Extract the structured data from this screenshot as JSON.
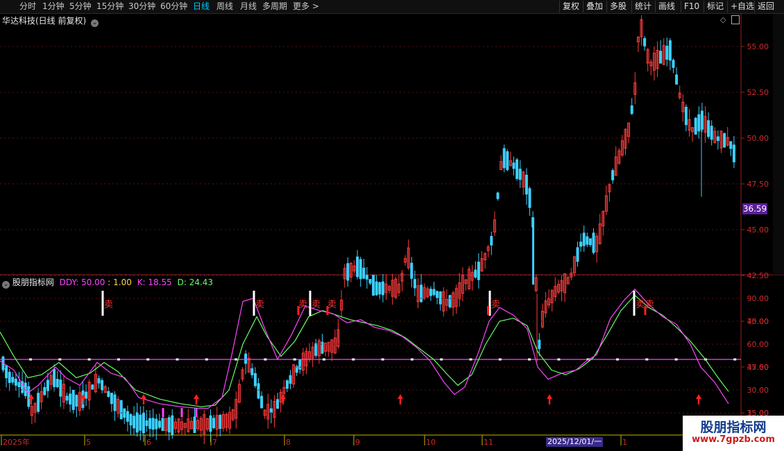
{
  "toolbar": {
    "periods": [
      "分时",
      "1分钟",
      "5分钟",
      "15分钟",
      "30分钟",
      "60分钟",
      "日线",
      "周线",
      "月线",
      "多周期",
      "更多 >"
    ],
    "active_period": "日线",
    "buttons": [
      "复权",
      "叠加",
      "多股",
      "统计",
      "画线",
      "F10",
      "标记",
      "+自选",
      "返回"
    ]
  },
  "stock": {
    "title": "华达科技(日线 前复权)",
    "current_price_tag": "36.59"
  },
  "price_axis": {
    "ticks": [
      "55.00",
      "52.50",
      "50.00",
      "47.50",
      "45.00",
      "42.50",
      "40.00",
      "37.50",
      "35.00"
    ]
  },
  "indicator": {
    "name": "股朋指标网",
    "ddy_label": "DDY: 50.00",
    "one_label": ": 1.00",
    "k_label": "K: 18.55",
    "d_label": "D: 24.43",
    "sell_text": "卖",
    "ticks": [
      "90.00",
      "75.00",
      "60.00",
      "45.00",
      "30.00",
      "15.00"
    ],
    "colors": {
      "k": "#ff44ff",
      "d": "#66ff66",
      "ddy": "#ff44ff",
      "sell": "#ff3030",
      "buy_arrow": "#ff2020"
    }
  },
  "time_axis": {
    "labels": [
      "2025年",
      "5",
      "6",
      "7",
      "8",
      "9",
      "10",
      "11",
      "1"
    ],
    "date_pill": "2025/12/01/一"
  },
  "watermark": {
    "line1": "股朋指标网",
    "line2": "www.7gpzb.com"
  }
}
